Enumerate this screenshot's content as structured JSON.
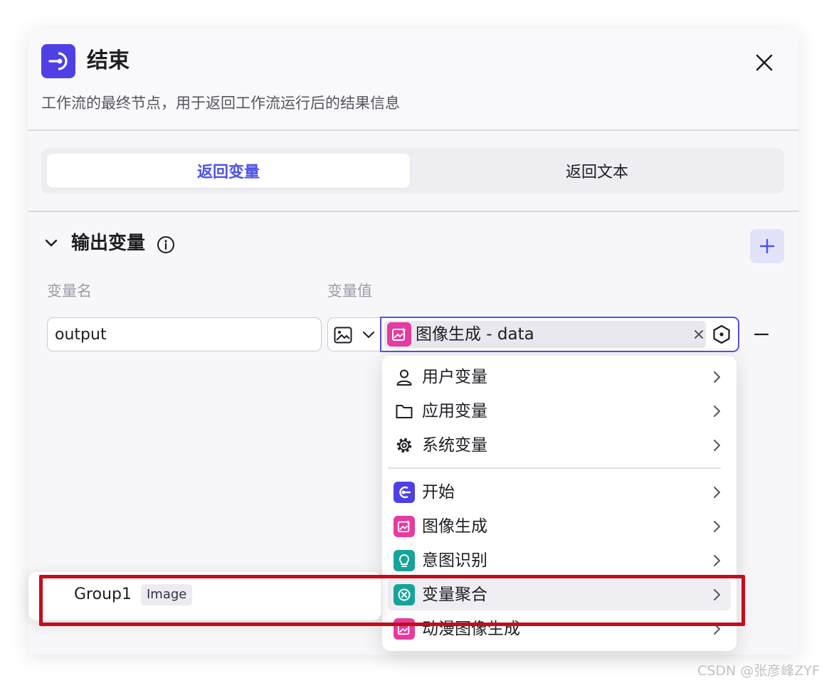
{
  "node": {
    "title": "结束",
    "description": "工作流的最终节点，用于返回工作流运行后的结果信息"
  },
  "tabs": [
    {
      "label": "返回变量",
      "active": true
    },
    {
      "label": "返回文本",
      "active": false
    }
  ],
  "output_section": {
    "title": "输出变量",
    "col_name": "变量名",
    "col_value": "变量值",
    "row": {
      "name": "output",
      "value_tag": "图像生成 - data"
    }
  },
  "menu": {
    "items": [
      {
        "label": "用户变量",
        "icon": "user-icon"
      },
      {
        "label": "应用变量",
        "icon": "folder-icon"
      },
      {
        "label": "系统变量",
        "icon": "gear-icon"
      },
      {
        "label": "开始",
        "icon": "start-node-icon",
        "color": "#4e40e5"
      },
      {
        "label": "图像生成",
        "icon": "image-generate-icon",
        "color": "#e63ba0"
      },
      {
        "label": "意图识别",
        "icon": "intent-bulb-icon",
        "color": "#16a39a"
      },
      {
        "label": "变量聚合",
        "icon": "aggregate-icon",
        "color": "#16a39a"
      },
      {
        "label": "动漫图像生成",
        "icon": "anime-image-icon",
        "color": "#e63ba0"
      }
    ]
  },
  "submenu": {
    "item_label": "Group1",
    "badge": "Image"
  },
  "watermark": "CSDN @张彦峰ZYF",
  "colors": {
    "primary": "#4d53e8",
    "node_end": "#4e40e5",
    "image_node": "#e63ba0",
    "teal_node": "#16a39a",
    "highlight": "#c40c1b"
  }
}
